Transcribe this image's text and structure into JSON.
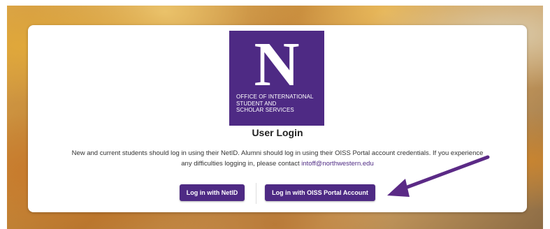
{
  "logo": {
    "letter": "N",
    "lines": [
      "OFFICE OF INTERNATIONAL",
      "STUDENT AND",
      "SCHOLAR SERVICES"
    ],
    "color": "#4E2A84"
  },
  "login": {
    "title": "User Login",
    "description": "New and current students should log in using their NetID. Alumni should log in using their OISS Portal account credentials. If you experience any difficulties logging in, please contact ",
    "contact_email": "intoff@northwestern.edu"
  },
  "buttons": {
    "netid_label": "Log in with NetID",
    "oiss_label": "Log in with OISS Portal Account"
  },
  "annotation": {
    "arrow_color": "#5B2A86"
  }
}
